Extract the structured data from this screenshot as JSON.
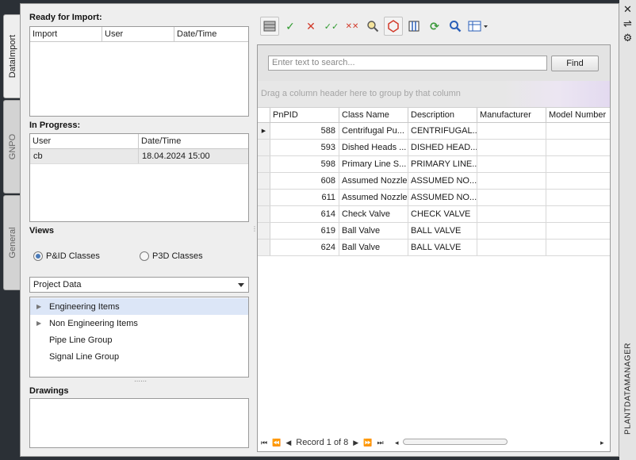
{
  "vertical_tabs": [
    {
      "label": "DataImport",
      "active": true
    },
    {
      "label": "GNPO",
      "active": false
    },
    {
      "label": "General",
      "active": false
    }
  ],
  "ready_for_import": {
    "title": "Ready for Import:",
    "columns": [
      "Import",
      "User",
      "Date/Time"
    ]
  },
  "in_progress": {
    "title": "In Progress:",
    "columns": [
      "User",
      "Date/Time"
    ],
    "rows": [
      {
        "user": "cb",
        "datetime": "18.04.2024 15:00"
      }
    ]
  },
  "views": {
    "title": "Views",
    "options": [
      {
        "label": "P&ID Classes",
        "selected": true
      },
      {
        "label": "P3D Classes",
        "selected": false
      }
    ],
    "dropdown_value": "Project Data",
    "tree": [
      {
        "label": "Engineering Items",
        "expandable": true,
        "selected": true
      },
      {
        "label": "Non Engineering Items",
        "expandable": true,
        "selected": false
      },
      {
        "label": "Pipe Line Group",
        "expandable": false,
        "selected": false
      },
      {
        "label": "Signal Line Group",
        "expandable": false,
        "selected": false
      }
    ]
  },
  "drawings": {
    "title": "Drawings"
  },
  "toolbar": {
    "icons": [
      "grid-view-icon",
      "check-icon",
      "cross-icon",
      "check-all-icon",
      "cross-all-icon",
      "zoom-icon",
      "polygon-icon",
      "columns-icon",
      "refresh-icon",
      "search-icon",
      "table-settings-icon"
    ]
  },
  "search": {
    "placeholder": "Enter text to search...",
    "find_label": "Find"
  },
  "group_hint": "Drag a column header here to group by that column",
  "grid": {
    "columns": [
      "PnPID",
      "Class Name",
      "Description",
      "Manufacturer",
      "Model Number"
    ],
    "rows": [
      {
        "pnpid": "588",
        "class_name": "Centrifugal Pu...",
        "description": "CENTRIFUGAL...",
        "manufacturer": "",
        "model": ""
      },
      {
        "pnpid": "593",
        "class_name": "Dished Heads ...",
        "description": "DISHED HEAD...",
        "manufacturer": "",
        "model": ""
      },
      {
        "pnpid": "598",
        "class_name": "Primary Line S...",
        "description": "PRIMARY LINE...",
        "manufacturer": "",
        "model": ""
      },
      {
        "pnpid": "608",
        "class_name": "Assumed Nozzle",
        "description": "ASSUMED NO...",
        "manufacturer": "",
        "model": ""
      },
      {
        "pnpid": "611",
        "class_name": "Assumed Nozzle",
        "description": "ASSUMED NO...",
        "manufacturer": "",
        "model": ""
      },
      {
        "pnpid": "614",
        "class_name": "Check Valve",
        "description": "CHECK VALVE",
        "manufacturer": "",
        "model": ""
      },
      {
        "pnpid": "619",
        "class_name": "Ball Valve",
        "description": "BALL VALVE",
        "manufacturer": "",
        "model": ""
      },
      {
        "pnpid": "624",
        "class_name": "Ball Valve",
        "description": "BALL VALVE",
        "manufacturer": "",
        "model": ""
      }
    ]
  },
  "navigator": {
    "record_text": "Record 1 of 8"
  },
  "palette": {
    "title": "PLANTDATAMANAGER"
  },
  "colors": {
    "panel_bg": "#eeeeee",
    "check_green": "#2e9a2e",
    "cross_red": "#d23a2a",
    "refresh_green": "#3b9a3b",
    "search_blue": "#2a5fb8"
  }
}
